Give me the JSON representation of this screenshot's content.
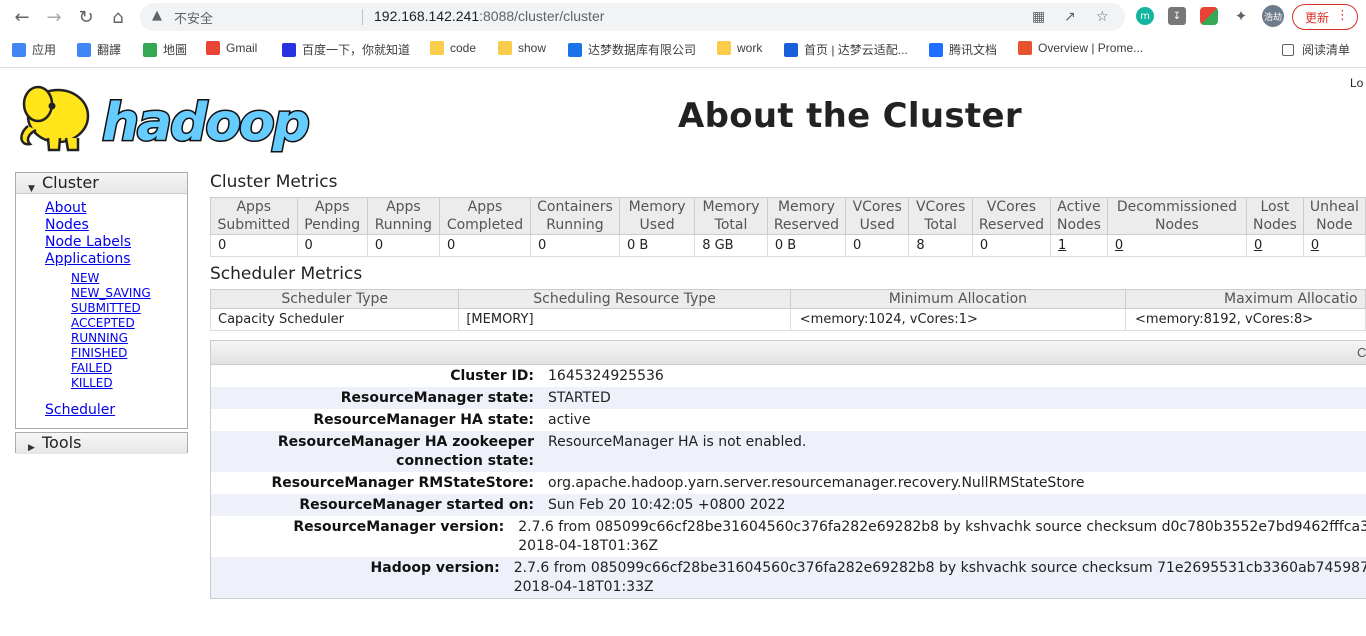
{
  "browser": {
    "insecure_label": "不安全",
    "url_host": "192.168.142.241",
    "url_rest": ":8088/cluster/cluster",
    "update_label": "更新",
    "profile_label": "浩劫",
    "ext_m_label": "m"
  },
  "bookmarks": [
    {
      "label": "应用",
      "icon": "apps-grid-icon",
      "color": "#4285f4"
    },
    {
      "label": "翻譯",
      "icon": "translate-icon",
      "color": "#4285f4"
    },
    {
      "label": "地圖",
      "icon": "maps-pin-icon",
      "color": "#34a853"
    },
    {
      "label": "Gmail",
      "icon": "gmail-icon",
      "color": "#ea4335"
    },
    {
      "label": "百度一下，你就知道",
      "icon": "baidu-paw-icon",
      "color": "#2932e1"
    },
    {
      "label": "code",
      "icon": "folder-icon",
      "color": "#f9cc4a"
    },
    {
      "label": "show",
      "icon": "folder-icon",
      "color": "#f9cc4a"
    },
    {
      "label": "达梦数据库有限公司",
      "icon": "dameng-icon",
      "color": "#1a73e8"
    },
    {
      "label": "work",
      "icon": "folder-icon",
      "color": "#f9cc4a"
    },
    {
      "label": "首页 | 达梦云适配...",
      "icon": "dameng-d-icon",
      "color": "#1a5fd8"
    },
    {
      "label": "腾讯文档",
      "icon": "tencent-docs-icon",
      "color": "#1e6fff"
    },
    {
      "label": "Overview | Prome...",
      "icon": "prometheus-icon",
      "color": "#e6522c"
    }
  ],
  "reading_list": "阅读清单",
  "header": {
    "logo_text": "hadoop",
    "title": "About the Cluster",
    "logged_in": "Lo"
  },
  "nav": {
    "cluster_label": "Cluster",
    "tools_label": "Tools",
    "links": [
      "About",
      "Nodes",
      "Node Labels",
      "Applications"
    ],
    "app_states": [
      "NEW",
      "NEW_SAVING",
      "SUBMITTED",
      "ACCEPTED",
      "RUNNING",
      "FINISHED",
      "FAILED",
      "KILLED"
    ],
    "scheduler_label": "Scheduler"
  },
  "cluster_metrics": {
    "title": "Cluster Metrics",
    "headers": [
      [
        "Apps",
        "Submitted"
      ],
      [
        "Apps",
        "Pending"
      ],
      [
        "Apps",
        "Running"
      ],
      [
        "Apps",
        "Completed"
      ],
      [
        "Containers",
        "Running"
      ],
      [
        "Memory",
        "Used"
      ],
      [
        "Memory",
        "Total"
      ],
      [
        "Memory",
        "Reserved"
      ],
      [
        "VCores",
        "Used"
      ],
      [
        "VCores",
        "Total"
      ],
      [
        "VCores",
        "Reserved"
      ],
      [
        "Active",
        "Nodes"
      ],
      [
        "Decommissioned",
        "Nodes"
      ],
      [
        "Lost",
        "Nodes"
      ],
      [
        "Unheal",
        "Node"
      ]
    ],
    "values": [
      "0",
      "0",
      "0",
      "0",
      "0",
      "0 B",
      "8 GB",
      "0 B",
      "0",
      "8",
      "0",
      "1",
      "0",
      "0",
      "0"
    ]
  },
  "scheduler_metrics": {
    "title": "Scheduler Metrics",
    "headers": [
      "Scheduler Type",
      "Scheduling Resource Type",
      "Minimum Allocation",
      "Maximum Allocatio"
    ],
    "values": [
      "Capacity Scheduler",
      "[MEMORY]",
      "<memory:1024, vCores:1>",
      "<memory:8192, vCores:8>"
    ]
  },
  "cluster_info": {
    "head_label": "C",
    "rows": [
      {
        "label": "Cluster ID:",
        "value": [
          "1645324925536"
        ]
      },
      {
        "label": "ResourceManager state:",
        "value": [
          "STARTED"
        ]
      },
      {
        "label": "ResourceManager HA state:",
        "value": [
          "active"
        ]
      },
      {
        "label": "ResourceManager HA zookeeper connection state:",
        "value": [
          "ResourceManager HA is not enabled."
        ]
      },
      {
        "label": "ResourceManager RMStateStore:",
        "value": [
          "org.apache.hadoop.yarn.server.resourcemanager.recovery.NullRMStateStore"
        ]
      },
      {
        "label": "ResourceManager started on:",
        "value": [
          "Sun Feb 20 10:42:05 +0800 2022"
        ]
      },
      {
        "label": "ResourceManager version:",
        "value": [
          "2.7.6 from 085099c66cf28be31604560c376fa282e69282b8 by kshvachk source checksum d0c780b3552e7bd9462fffca3",
          "2018-04-18T01:36Z"
        ]
      },
      {
        "label": "Hadoop version:",
        "value": [
          "2.7.6 from 085099c66cf28be31604560c376fa282e69282b8 by kshvachk source checksum 71e2695531cb3360ab745987",
          "2018-04-18T01:33Z"
        ]
      }
    ]
  }
}
